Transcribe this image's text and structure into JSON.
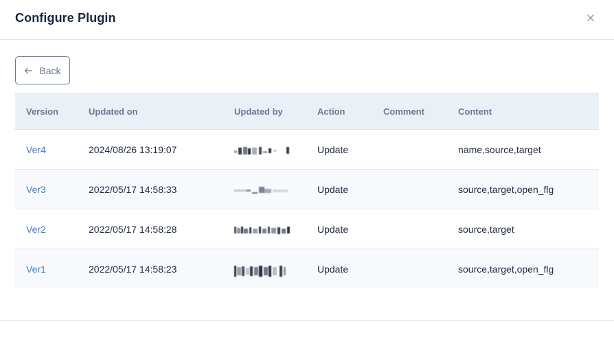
{
  "modal": {
    "title": "Configure Plugin",
    "close_icon": "close-icon"
  },
  "back_button": {
    "icon": "arrow-left-icon",
    "label": "Back"
  },
  "table": {
    "headers": [
      "Version",
      "Updated on",
      "Updated by",
      "Action",
      "Comment",
      "Content"
    ],
    "rows": [
      {
        "version": "Ver4",
        "updated_on": "2024/08/26 13:19:07",
        "updated_by": "",
        "action": "Update",
        "comment": "",
        "content": "name,source,target"
      },
      {
        "version": "Ver3",
        "updated_on": "2022/05/17 14:58:33",
        "updated_by": "",
        "action": "Update",
        "comment": "",
        "content": "source,target,open_flg"
      },
      {
        "version": "Ver2",
        "updated_on": "2022/05/17 14:58:28",
        "updated_by": "",
        "action": "Update",
        "comment": "",
        "content": "source,target"
      },
      {
        "version": "Ver1",
        "updated_on": "2022/05/17 14:58:23",
        "updated_by": "",
        "action": "Update",
        "comment": "",
        "content": "source,target,open_flg"
      }
    ]
  },
  "colors": {
    "link": "#3f7fc8",
    "header_bg": "#ebf0f7",
    "text": "#1f2a44",
    "muted": "#6b7896"
  }
}
